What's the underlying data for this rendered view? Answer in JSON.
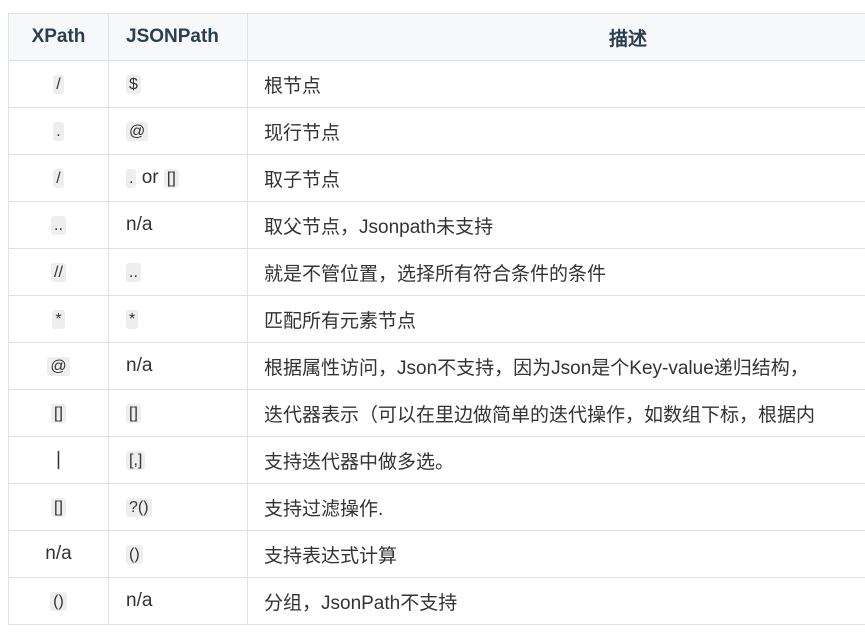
{
  "table": {
    "headers": [
      "XPath",
      "JSONPath",
      "描述"
    ],
    "rows": [
      {
        "xpath": "/",
        "xpath_code": true,
        "jsonpath": [
          "$"
        ],
        "jsonpath_code": [
          true
        ],
        "desc": "根节点"
      },
      {
        "xpath": ".",
        "xpath_code": true,
        "jsonpath": [
          "@"
        ],
        "jsonpath_code": [
          true
        ],
        "desc": "现行节点"
      },
      {
        "xpath": "/",
        "xpath_code": true,
        "jsonpath": [
          ".",
          " or ",
          "[]"
        ],
        "jsonpath_code": [
          true,
          false,
          true
        ],
        "desc": "取子节点"
      },
      {
        "xpath": "..",
        "xpath_code": true,
        "jsonpath": [
          "n/a"
        ],
        "jsonpath_code": [
          false
        ],
        "desc": "取父节点，Jsonpath未支持"
      },
      {
        "xpath": "//",
        "xpath_code": true,
        "jsonpath": [
          ".."
        ],
        "jsonpath_code": [
          true
        ],
        "desc": "就是不管位置，选择所有符合条件的条件"
      },
      {
        "xpath": "*",
        "xpath_code": true,
        "jsonpath": [
          "*"
        ],
        "jsonpath_code": [
          true
        ],
        "desc": "匹配所有元素节点"
      },
      {
        "xpath": "@",
        "xpath_code": true,
        "jsonpath": [
          "n/a"
        ],
        "jsonpath_code": [
          false
        ],
        "desc": "根据属性访问，Json不支持，因为Json是个Key-value递归结构，"
      },
      {
        "xpath": "[]",
        "xpath_code": true,
        "jsonpath": [
          "[]"
        ],
        "jsonpath_code": [
          true
        ],
        "desc": "迭代器表示（可以在里边做简单的迭代操作，如数组下标，根据内"
      },
      {
        "xpath": "|",
        "xpath_code": false,
        "jsonpath": [
          "[,]"
        ],
        "jsonpath_code": [
          true
        ],
        "desc": "支持迭代器中做多选。"
      },
      {
        "xpath": "[]",
        "xpath_code": true,
        "jsonpath": [
          "?()"
        ],
        "jsonpath_code": [
          true
        ],
        "desc": "支持过滤操作."
      },
      {
        "xpath": "n/a",
        "xpath_code": false,
        "jsonpath": [
          "()"
        ],
        "jsonpath_code": [
          true
        ],
        "desc": "支持表达式计算"
      },
      {
        "xpath": "()",
        "xpath_code": true,
        "jsonpath": [
          "n/a"
        ],
        "jsonpath_code": [
          false
        ],
        "desc": "分组，JsonPath不支持"
      }
    ]
  }
}
